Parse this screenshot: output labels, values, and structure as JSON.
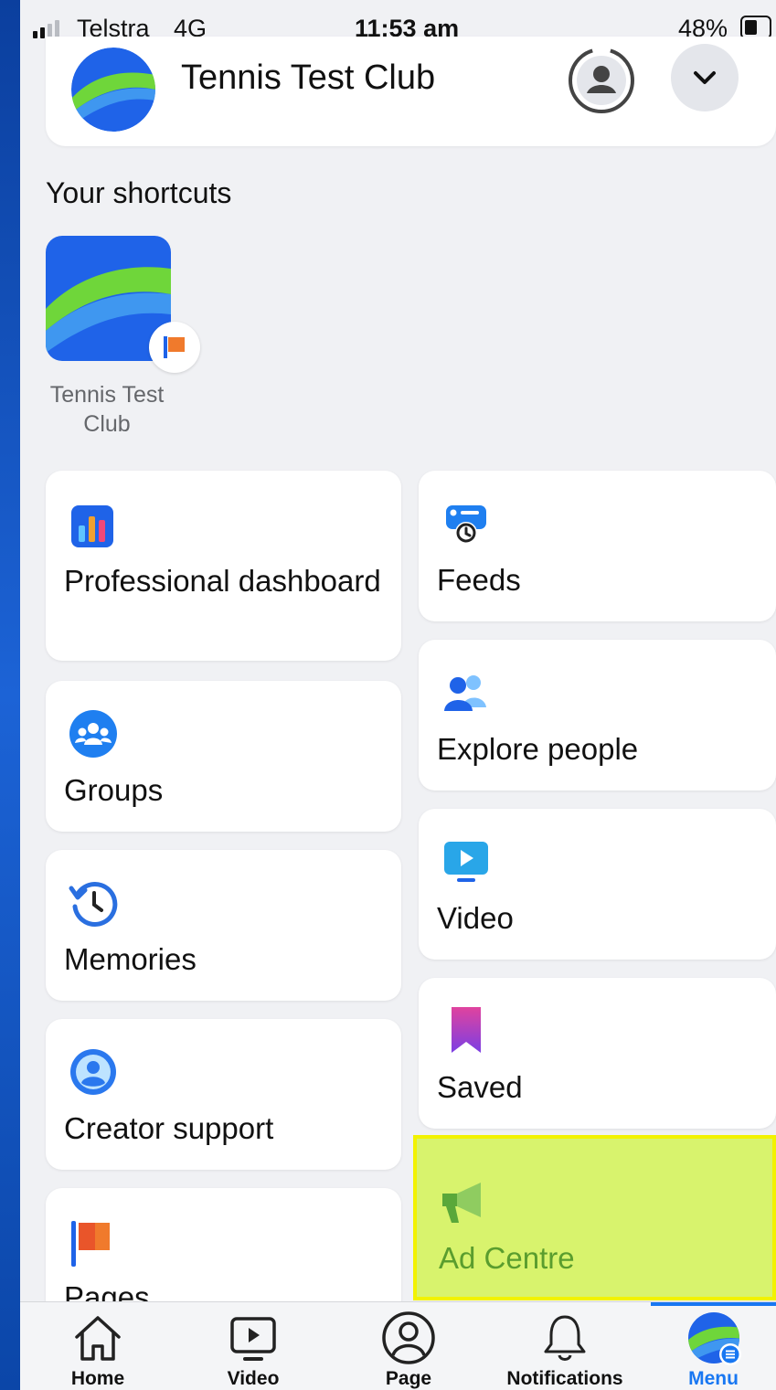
{
  "status_bar": {
    "carrier": "Telstra",
    "network": "4G",
    "time": "11:53 am",
    "battery": "48%",
    "signal_level": 0.5
  },
  "header": {
    "page_name": "Tennis Test Club",
    "profile_switch_icon": "profile-switch-icon",
    "dropdown_icon": "chevron-down-icon"
  },
  "shortcuts": {
    "heading": "Your shortcuts",
    "items": [
      {
        "label": "Tennis Test Club",
        "badge_icon": "flag-icon"
      }
    ]
  },
  "menu": {
    "left_column": [
      {
        "label": "Professional dashboard",
        "icon": "bar-chart-icon"
      },
      {
        "label": "Groups",
        "icon": "groups-icon"
      },
      {
        "label": "Memories",
        "icon": "memories-clock-icon"
      },
      {
        "label": "Creator support",
        "icon": "creator-support-icon"
      },
      {
        "label": "Pages",
        "icon": "pages-flag-icon"
      }
    ],
    "right_column": [
      {
        "label": "Feeds",
        "icon": "feeds-icon"
      },
      {
        "label": "Explore people",
        "icon": "explore-people-icon"
      },
      {
        "label": "Video",
        "icon": "video-icon"
      },
      {
        "label": "Saved",
        "icon": "saved-bookmark-icon"
      },
      {
        "label": "Ad Centre",
        "icon": "megaphone-icon",
        "highlighted": true
      }
    ]
  },
  "bottom_nav": {
    "items": [
      {
        "label": "Home",
        "icon": "home-icon",
        "active": false
      },
      {
        "label": "Video",
        "icon": "video-play-icon",
        "active": false
      },
      {
        "label": "Page",
        "icon": "page-profile-icon",
        "active": false
      },
      {
        "label": "Notifications",
        "icon": "bell-icon",
        "active": false
      },
      {
        "label": "Menu",
        "icon": "menu-avatar-icon",
        "active": true
      }
    ]
  },
  "colors": {
    "background": "#f0f1f4",
    "card": "#ffffff",
    "accent_blue": "#1877f2",
    "highlight_fill": "#d8f36d",
    "highlight_border": "#f2f200",
    "highlight_text": "#5a9d2e"
  }
}
